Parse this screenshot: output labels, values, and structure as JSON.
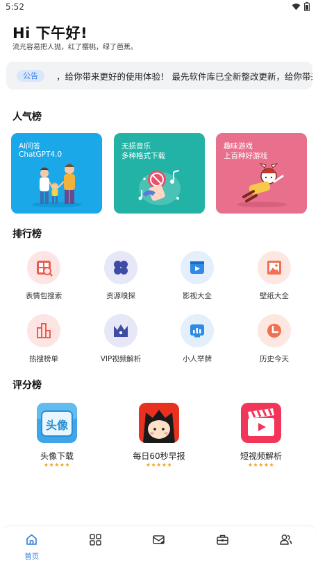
{
  "status": {
    "time": "5:52"
  },
  "header": {
    "greeting": "Hi 下午好!",
    "subtitle": "流光容易把人抛，红了樱桃，绿了芭蕉。"
  },
  "notice": {
    "badge": "公告",
    "text": "，给你带来更好的使用体验！    最先软件库已全新整改更新，给你带来更好的使用体验！"
  },
  "popular": {
    "title": "人气榜",
    "cards": [
      {
        "line1": "AI问答",
        "line2": "ChatGPT4.0",
        "color": "#1aa8e8"
      },
      {
        "line1": "无损音乐",
        "line2": "多种格式下载",
        "color": "#22b3a6"
      },
      {
        "line1": "趣味游戏",
        "line2": "上百种好游戏",
        "color": "#e8708d"
      }
    ]
  },
  "ranking": {
    "title": "排行榜",
    "items": [
      {
        "label": "表情包搜索",
        "icon": "emoji-search-icon",
        "bg": "#fde5e3",
        "fg": "#ef5a4e"
      },
      {
        "label": "资源嗅探",
        "icon": "four-leaf-icon",
        "bg": "#e6e8f7",
        "fg": "#3e4da3"
      },
      {
        "label": "影视大全",
        "icon": "video-icon",
        "bg": "#e3effb",
        "fg": "#2e8ae6"
      },
      {
        "label": "壁纸大全",
        "icon": "wallpaper-icon",
        "bg": "#fde8e1",
        "fg": "#f07050"
      },
      {
        "label": "热搜榜单",
        "icon": "hot-chart-icon",
        "bg": "#fde5e3",
        "fg": "#ef5a4e"
      },
      {
        "label": "VIP视频解析",
        "icon": "crown-icon",
        "bg": "#e6e8f7",
        "fg": "#3e4da3"
      },
      {
        "label": "小人举牌",
        "icon": "sign-board-icon",
        "bg": "#e3effb",
        "fg": "#2e8ae6"
      },
      {
        "label": "历史今天",
        "icon": "clock-icon",
        "bg": "#fde8e1",
        "fg": "#f07050"
      }
    ]
  },
  "rating": {
    "title": "评分榜",
    "items": [
      {
        "label": "头像下载",
        "stars": "★★★★★",
        "badge_text": "头像"
      },
      {
        "label": "每日60秒早报",
        "stars": "★★★★★"
      },
      {
        "label": "短视频解析",
        "stars": "★★★★★"
      }
    ]
  },
  "nav": {
    "active": "首页",
    "items": [
      {
        "icon": "home-icon",
        "label": "首页"
      },
      {
        "icon": "apps-grid-icon"
      },
      {
        "icon": "mail-icon"
      },
      {
        "icon": "toolbox-icon"
      },
      {
        "icon": "users-icon"
      }
    ]
  }
}
